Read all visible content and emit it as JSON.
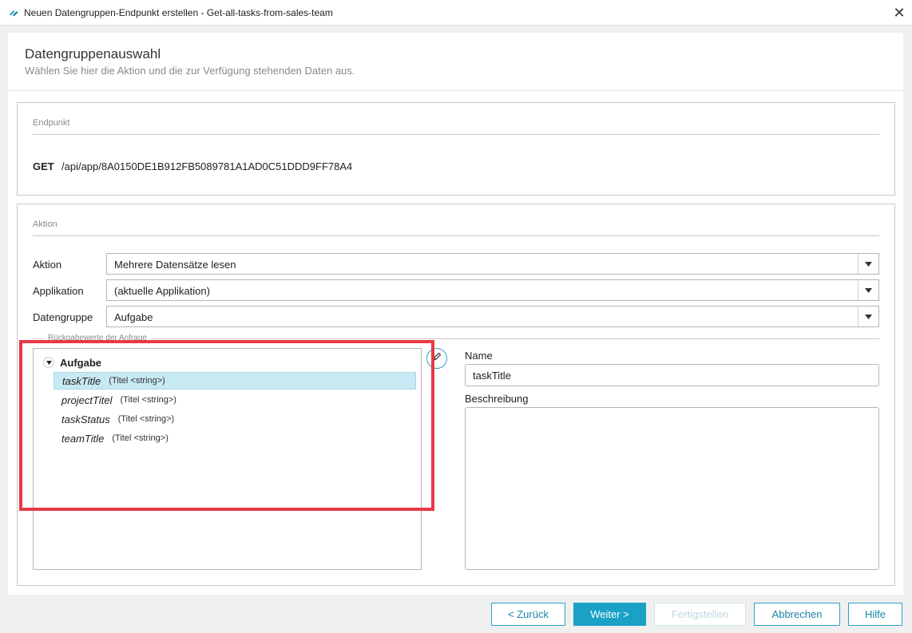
{
  "window": {
    "title": "Neuen Datengruppen-Endpunkt erstellen - Get-all-tasks-from-sales-team",
    "close_symbol": "✕"
  },
  "header": {
    "title": "Datengruppenauswahl",
    "subtitle": "Wählen Sie hier die Aktion und die zur Verfügung stehenden Daten aus."
  },
  "endpoint": {
    "legend": "Endpunkt",
    "method": "GET",
    "path": "/api/app/8A0150DE1B912FB5089781A1AD0C51DDD9FF78A4"
  },
  "action": {
    "legend": "Aktion",
    "fields": [
      {
        "label": "Aktion",
        "value": "Mehrere Datensätze lesen"
      },
      {
        "label": "Applikation",
        "value": "(aktuelle Applikation)"
      },
      {
        "label": "Datengruppe",
        "value": "Aufgabe"
      }
    ],
    "return_values_legend": "Rückgabewerte der Anfrage"
  },
  "tree": {
    "root": "Aufgabe",
    "items": [
      {
        "name": "taskTitle",
        "type": "(Titel <string>)",
        "selected": true
      },
      {
        "name": "projectTitel",
        "type": "(Titel <string>)",
        "selected": false
      },
      {
        "name": "taskStatus",
        "type": "(Titel <string>)",
        "selected": false
      },
      {
        "name": "teamTitle",
        "type": "(Titel <string>)",
        "selected": false
      }
    ]
  },
  "details": {
    "name_label": "Name",
    "name_value": "taskTitle",
    "description_label": "Beschreibung",
    "description_value": ""
  },
  "footer": {
    "back": "< Zurück",
    "next": "Weiter >",
    "finish": "Fertigstellen",
    "cancel": "Abbrechen",
    "help": "Hilfe"
  },
  "colors": {
    "accent": "#1ba1c5",
    "selection": "#c7e9f3",
    "highlight": "#e63946"
  },
  "icons": {
    "app": "app-logo-icon",
    "close": "close-icon",
    "dropdown": "chevron-down-icon",
    "tree_toggle": "triangle-down-icon",
    "edit": "pencil-icon"
  }
}
